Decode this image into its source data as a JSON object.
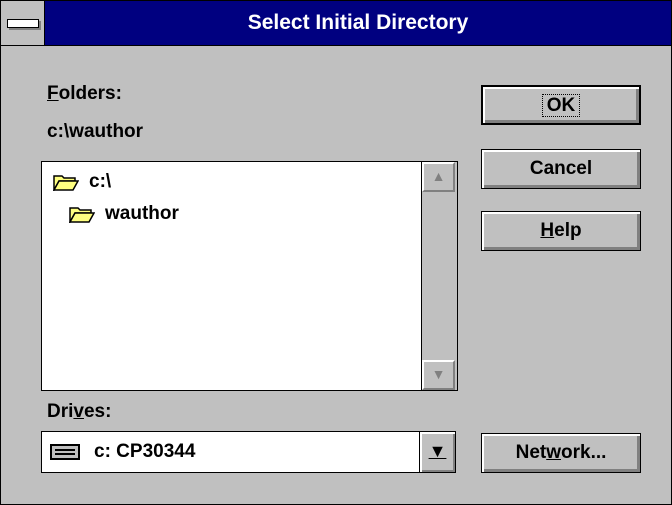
{
  "dialog": {
    "title": "Select Initial Directory"
  },
  "folders": {
    "label": "Folders:",
    "current_path": "c:\\wauthor",
    "items": [
      {
        "label": "c:\\",
        "icon": "open-folder-icon"
      },
      {
        "label": "wauthor",
        "icon": "open-folder-icon"
      }
    ]
  },
  "drives": {
    "label": "Drives:",
    "selected": "c: CP30344",
    "icon": "hard-drive-icon"
  },
  "buttons": {
    "ok": "OK",
    "cancel": "Cancel",
    "help": "Help",
    "network": "Network..."
  },
  "colors": {
    "titlebar": "#000080",
    "face": "#c0c0c0",
    "folder": "#ffff80"
  }
}
